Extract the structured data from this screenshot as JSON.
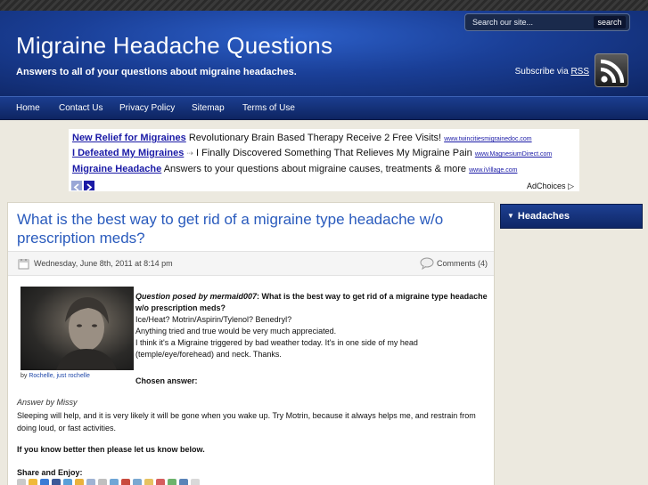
{
  "header": {
    "title": "Migraine Headache Questions",
    "tagline": "Answers to all of your questions about migraine headaches.",
    "search": {
      "placeholder": "Search our site...",
      "button": "search"
    },
    "subscribe_prefix": "Subscribe via",
    "subscribe_link": "RSS"
  },
  "nav": {
    "items": [
      {
        "label": "Home"
      },
      {
        "label": "Contact Us"
      },
      {
        "label": "Privacy Policy"
      },
      {
        "label": "Sitemap"
      },
      {
        "label": "Terms of Use"
      }
    ]
  },
  "ads": {
    "lines": [
      {
        "title": "New Relief for Migraines",
        "text": "Revolutionary Brain Based Therapy Receive 2 Free Visits!",
        "url": "www.twincitiesmigrainedoc.com"
      },
      {
        "title": "I Defeated My Migraines",
        "text": "I Finally Discovered Something That Relieves My Migraine Pain",
        "url": "www.MagnesiumDirect.com"
      },
      {
        "title": "Migraine Headache",
        "text": "Answers to your questions about migraine causes, treatments & more",
        "url": "www.iVillage.com"
      }
    ],
    "adchoices": "AdChoices"
  },
  "post": {
    "title": "What is the best way to get rid of a migraine type headache w/o prescription meds?",
    "date": "Wednesday, June 8th, 2011 at 8:14 pm",
    "comments": "Comments (4)",
    "photo_caption_prefix": "by",
    "photo_caption_link": "Rochelle, just rochelle",
    "question_intro": "Question posed by mermaid007",
    "question_head": ": What is the best way to get rid of a migraine type headache w/o prescription meds?",
    "question_lines": [
      "Ice/Heat? Motrin/Aspirin/Tylenol? Benedryl?",
      "Anything tried and true would be very much appreciated.",
      "I think it's a Migraine triggered by bad weather today. It's in one side of my head (temple/eye/forehead) and neck. Thanks."
    ],
    "chosen_answer": "Chosen answer:",
    "answer_by": "Answer by Missy",
    "answer_text": "Sleeping will help, and it is very likely it will be gone when you wake up. Try Motrin, because it always helps me, and restrain from doing loud, or fast activities.",
    "cta": "If you know better then please let us know below.",
    "share_title": "Share and Enjoy:"
  },
  "sidebar": {
    "widget_title": "Headaches"
  },
  "colors": {
    "header_blue": "#1a3f97",
    "link_blue": "#2a5bbd",
    "ad_link": "#1a1aa6",
    "page_bg": "#ece9df"
  },
  "icons": {
    "share": [
      "digg-icon",
      "reddit-icon",
      "delicious-icon",
      "facebook-icon",
      "stumbleupon-icon",
      "google-icon",
      "technorati-icon",
      "myspace-icon",
      "email-icon",
      "print-icon",
      "twitter-icon",
      "yahoo-icon",
      "friendfeed-icon",
      "mixx-icon",
      "linkedin-icon",
      "bookmark-icon"
    ]
  }
}
